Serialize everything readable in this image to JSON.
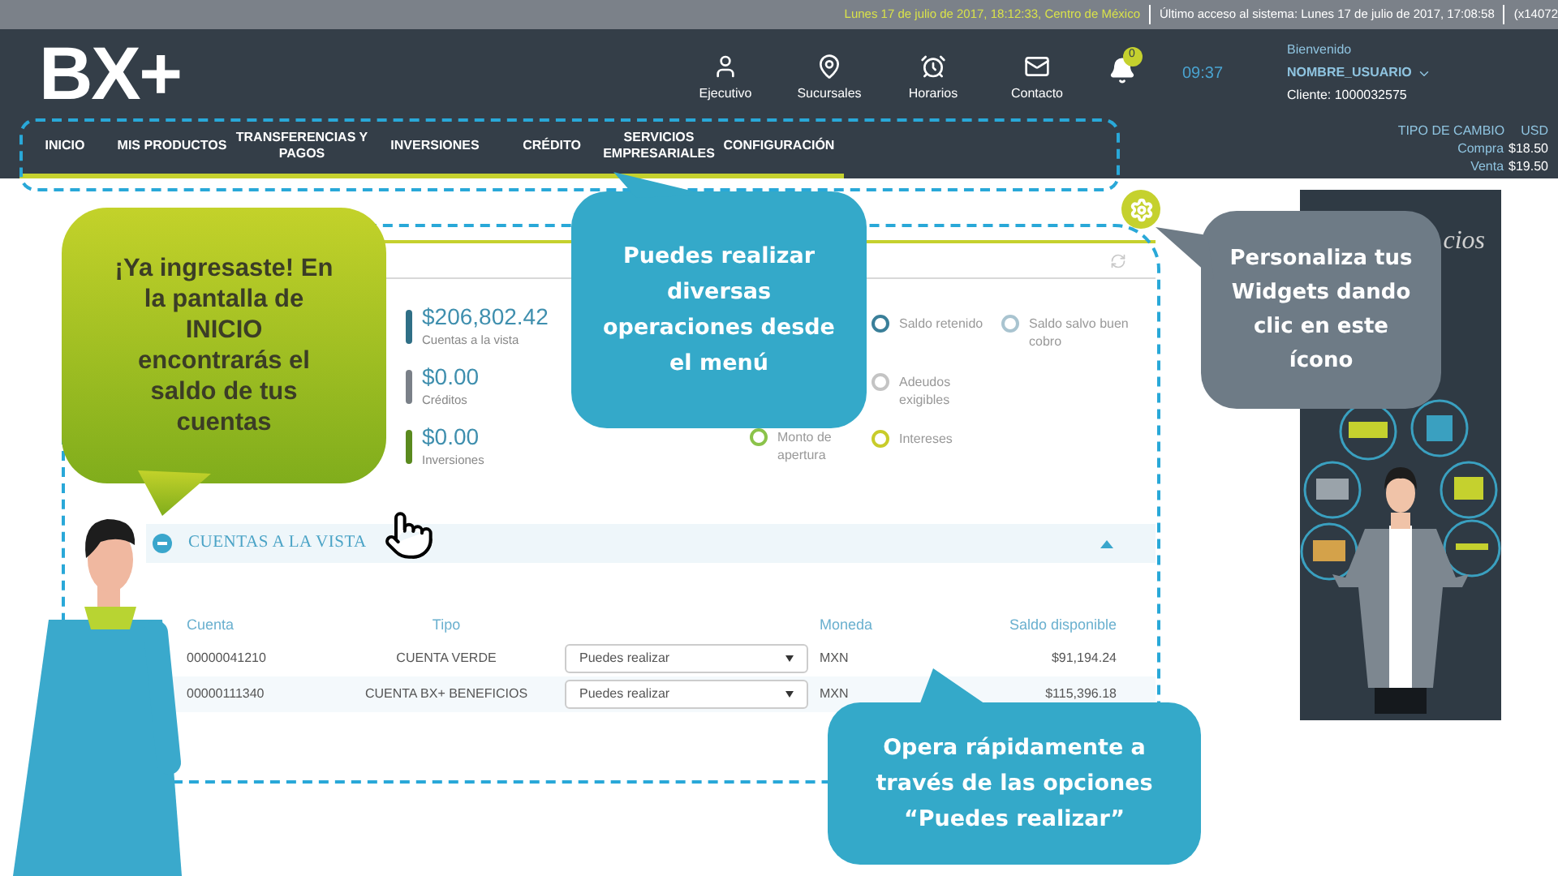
{
  "top_bar": {
    "datetime": "Lunes 17 de julio de 2017, 18:12:33, Centro de México",
    "last_access": "Último acceso al sistema: Lunes 17 de julio de 2017, 17:08:58",
    "session": "(x14072"
  },
  "header": {
    "logo": "BX+",
    "shortcuts": [
      {
        "label": "Ejecutivo",
        "kind": "person"
      },
      {
        "label": "Sucursales",
        "kind": "pin"
      },
      {
        "label": "Horarios",
        "kind": "clock"
      },
      {
        "label": "Contacto",
        "kind": "mail"
      }
    ],
    "notifications": "0",
    "time": "09:37",
    "user": {
      "greeting": "Bienvenido",
      "name": "NOMBRE_USUARIO",
      "client": "Cliente: 1000032575"
    }
  },
  "nav": [
    "INICIO",
    "MIS PRODUCTOS",
    "TRANSFERENCIAS Y PAGOS",
    "INVERSIONES",
    "CRÉDITO",
    "SERVICIOS EMPRESARIALES",
    "CONFIGURACIÓN"
  ],
  "exchange": {
    "title": "TIPO DE CAMBIO",
    "currency": "USD",
    "rows": [
      {
        "label": "Compra",
        "value": "$18.50"
      },
      {
        "label": "Venta",
        "value": "$19.50"
      }
    ]
  },
  "summary": {
    "balances": [
      {
        "amount": "$206,802.42",
        "label": "Cuentas a la vista",
        "color": "#2f6f86"
      },
      {
        "amount": "$0.00",
        "label": "Créditos",
        "color": "#7a8088"
      },
      {
        "amount": "$0.00",
        "label": "Inversiones",
        "color": "#5a8a1e"
      }
    ],
    "detail_columns": [
      [
        {
          "label": "Monto de apertura",
          "color": "#8bc34a"
        }
      ],
      [
        {
          "label": "Saldo retenido",
          "color": "#3a7f99"
        },
        {
          "label": "Adeudos exigibles",
          "color": "#c4c4c4"
        },
        {
          "label": "Intereses",
          "color": "#c8cc2a"
        }
      ],
      [
        {
          "label": "Saldo salvo buen cobro",
          "color": "#a9c4d0"
        }
      ]
    ]
  },
  "accounts": {
    "title": "CUENTAS A LA VISTA",
    "columns": [
      "Cuenta",
      "Tipo",
      "Moneda",
      "Saldo disponible"
    ],
    "rows": [
      {
        "account": "00000041210",
        "type": "CUENTA VERDE",
        "action": "Puedes realizar",
        "currency": "MXN",
        "balance": "$91,194.24"
      },
      {
        "account": "00000111340",
        "type": "CUENTA BX+ BENEFICIOS",
        "action": "Puedes realizar",
        "currency": "MXN",
        "balance": "$115,396.18"
      }
    ]
  },
  "promo": {
    "text": "cios"
  },
  "callouts": [
    "¡Ya ingresaste! En la pantalla de INICIO encontrarás el saldo de tus cuentas",
    "Puedes realizar diversas operaciones desde el menú",
    "Personaliza tus Widgets dando clic en este ícono",
    "Opera rápidamente a través de las opciones “Puedes realizar”"
  ]
}
